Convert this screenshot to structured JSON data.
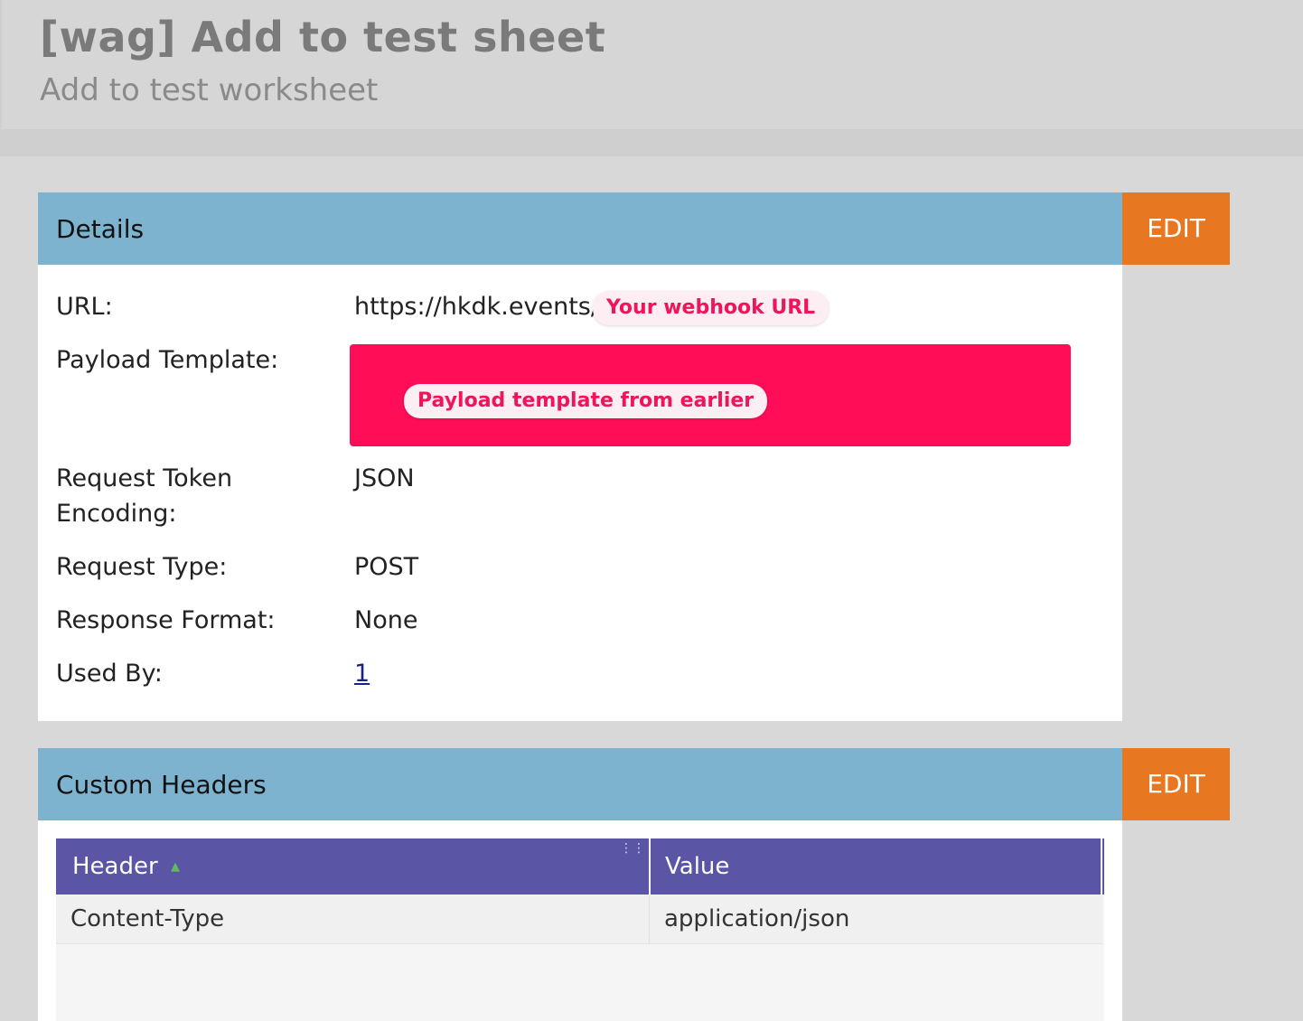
{
  "header": {
    "title": "[wag] Add to test sheet",
    "subtitle": "Add to test worksheet"
  },
  "details": {
    "title": "Details",
    "edit_label": "EDIT",
    "url_label": "URL:",
    "url_value": "https://hkdk.events/",
    "url_badge": "Your webhook URL",
    "payload_label": "Payload Template:",
    "payload_badge": "Payload template from earlier",
    "encoding_label": "Request Token Encoding:",
    "encoding_value": "JSON",
    "type_label": "Request Type:",
    "type_value": "POST",
    "response_label": "Response Format:",
    "response_value": "None",
    "used_by_label": "Used By:",
    "used_by_value": "1"
  },
  "custom_headers": {
    "title": "Custom Headers",
    "edit_label": "EDIT",
    "columns": [
      "Header",
      "Value"
    ],
    "rows": [
      [
        "Content-Type",
        "application/json"
      ]
    ]
  },
  "colors": {
    "panel_header": "#7db3cf",
    "edit_button": "#e87722",
    "grid_header": "#5a55a5",
    "payload_highlight": "#ff0d57",
    "badge_text": "#f0155a"
  }
}
